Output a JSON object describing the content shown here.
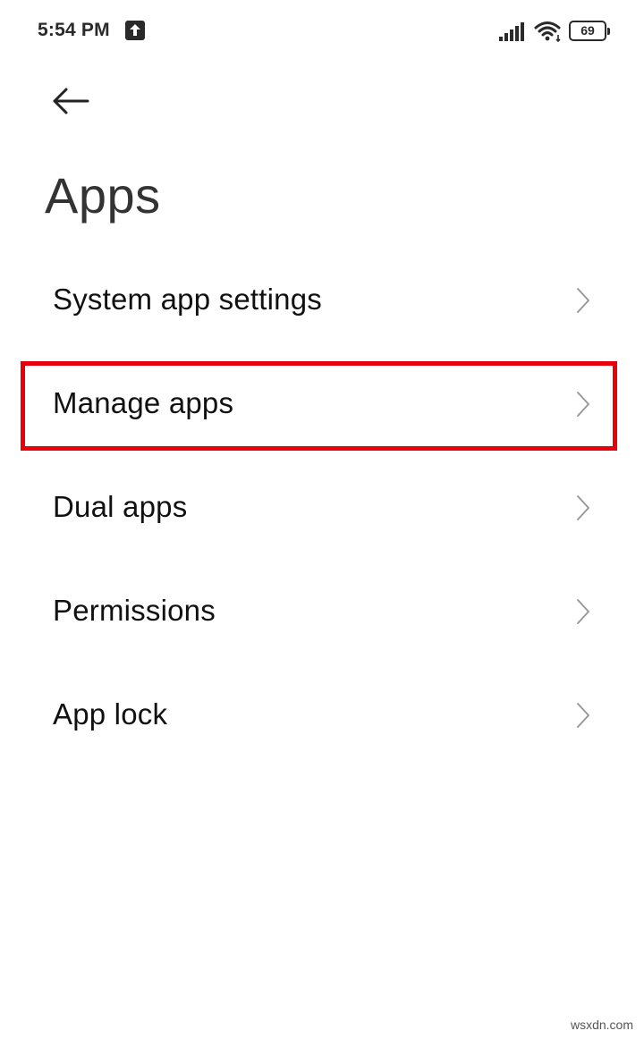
{
  "status_bar": {
    "time": "5:54 PM",
    "battery_level": "69",
    "icons": [
      "upload-notification-icon",
      "signal-icon",
      "wifi-icon",
      "battery-icon"
    ]
  },
  "header": {
    "back_icon": "back-arrow-icon",
    "title": "Apps"
  },
  "menu": {
    "items": [
      {
        "label": "System app settings",
        "icon": "chevron-right-icon"
      },
      {
        "label": "Manage apps",
        "icon": "chevron-right-icon",
        "highlighted": true
      },
      {
        "label": "Dual apps",
        "icon": "chevron-right-icon"
      },
      {
        "label": "Permissions",
        "icon": "chevron-right-icon"
      },
      {
        "label": "App lock",
        "icon": "chevron-right-icon"
      }
    ]
  },
  "annotation": {
    "highlight_color": "#e8000a"
  },
  "watermark": "wsxdn.com"
}
